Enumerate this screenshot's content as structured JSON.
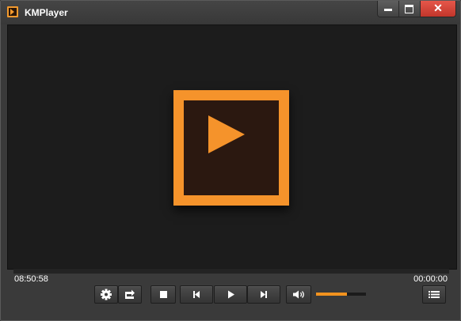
{
  "window": {
    "title": "KMPlayer",
    "close_glyph": "✕"
  },
  "player": {
    "elapsed_time": "08:50:58",
    "total_time": "00:00:00",
    "volume_level": 0.62
  },
  "icons": {
    "app": "kmplayer-logo-icon",
    "settings": "gear-icon",
    "capture": "capture-arrow-icon",
    "stop": "stop-icon",
    "previous": "skip-previous-icon",
    "play": "play-icon",
    "next": "skip-next-icon",
    "volume": "speaker-icon",
    "playlist": "playlist-icon"
  },
  "colors": {
    "accent": "#f5932b",
    "close_button": "#d9463a",
    "video_background": "#1c1c1c"
  }
}
